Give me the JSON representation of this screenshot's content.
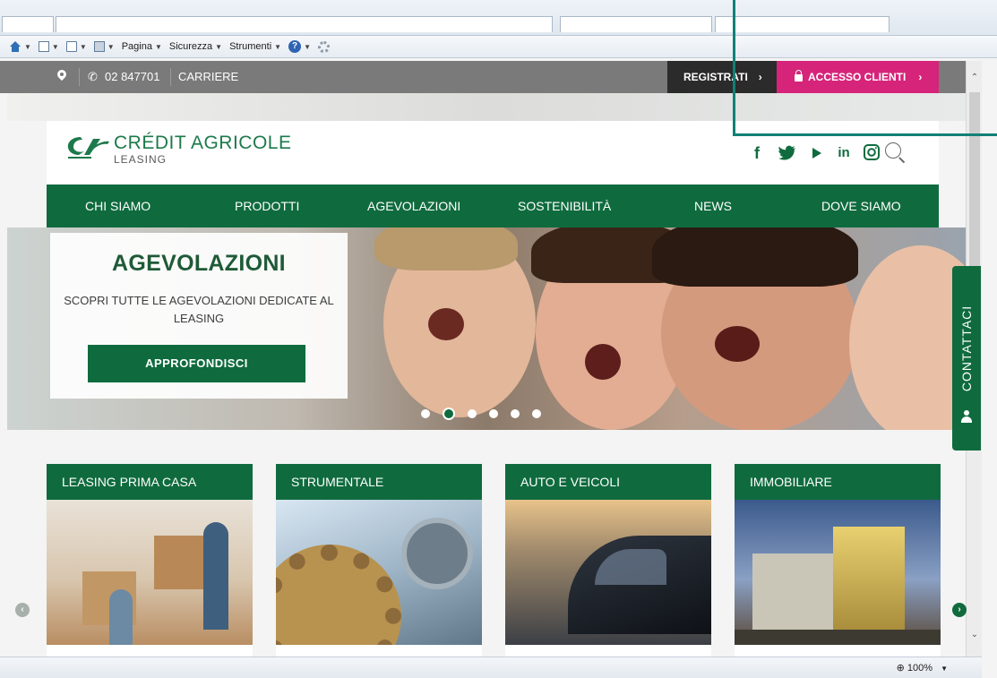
{
  "browser": {
    "commands": [
      {
        "label": "Pagina",
        "underline": "P"
      },
      {
        "label": "Sicurezza",
        "underline": "c"
      },
      {
        "label": "Strumenti",
        "underline": "S"
      }
    ],
    "zoom": "100%"
  },
  "topbar": {
    "phone": "02 847701",
    "careers": "CARRIERE",
    "register": "REGISTRATI",
    "client_access": "ACCESSO CLIENTI"
  },
  "header": {
    "logo_line1": "CRÉDIT AGRICOLE",
    "logo_line2": "LEASING",
    "social": [
      "f",
      "in"
    ]
  },
  "nav": [
    "CHI SIAMO",
    "PRODOTTI",
    "AGEVOLAZIONI",
    "SOSTENIBILITÀ",
    "NEWS",
    "DOVE SIAMO"
  ],
  "hero": {
    "title": "AGEVOLAZIONI",
    "subtitle": "SCOPRI TUTTE LE AGEVOLAZIONI DEDICATE AL LEASING",
    "cta": "APPROFONDISCI",
    "slides": 6,
    "active_slide": 2
  },
  "contact_tab": "CONTATTACI",
  "products": [
    "LEASING PRIMA CASA",
    "STRUMENTALE",
    "AUTO E VEICOLI",
    "IMMOBILIARE"
  ],
  "colors": {
    "brand_green": "#0f6b3e",
    "accent_pink": "#d6247a",
    "topbar_gray": "#7a7a7a",
    "highlight_teal": "#128076"
  }
}
